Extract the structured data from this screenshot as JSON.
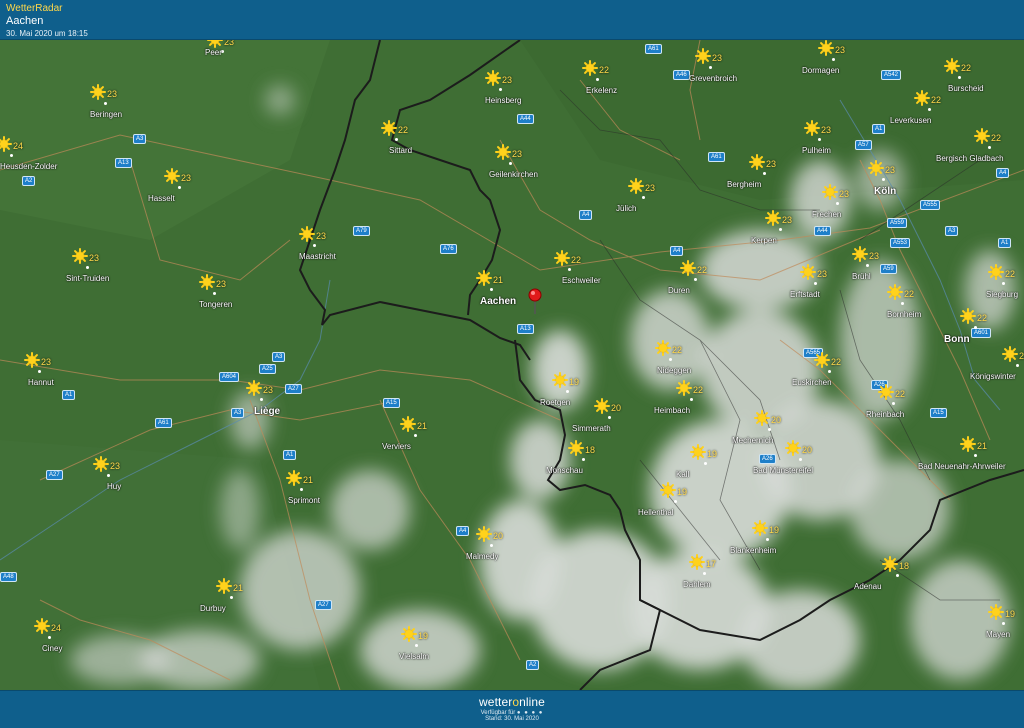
{
  "header": {
    "brand": "WetterRadar",
    "location": "Aachen",
    "timestamp": "30. Mai 2020 um 18:15"
  },
  "footer": {
    "logo_left": "wetter",
    "logo_o": "o",
    "logo_right": "nline",
    "availability": "Verfügbar für",
    "stand": "Stand: 30. Mai 2020"
  },
  "colors": {
    "map_green": "#3f6e34",
    "cloud": "#d8dbd8",
    "border": "#1c1c1c",
    "road_badge": "#1e7fc9",
    "temperature": "#ffd84a",
    "header": "#0f5f8c"
  },
  "marker_icon": "location-pin-icon",
  "weather_icons": {
    "sun": "sun-icon"
  },
  "cities": [
    {
      "name": "Peer",
      "temp": "23"
    },
    {
      "name": "Beringen",
      "temp": "23"
    },
    {
      "name": "Heinsberg",
      "temp": "23"
    },
    {
      "name": "Erkelenz",
      "temp": "22"
    },
    {
      "name": "Grevenbroich",
      "temp": "23"
    },
    {
      "name": "Dormagen",
      "temp": "23"
    },
    {
      "name": "Burscheid",
      "temp": "22"
    },
    {
      "name": "Sittard",
      "temp": "22"
    },
    {
      "name": "Leverkusen",
      "temp": "22"
    },
    {
      "name": "Pulheim",
      "temp": "23"
    },
    {
      "name": "Bergisch Gladbach",
      "temp": "22"
    },
    {
      "name": "Geilenkirchen",
      "temp": "23"
    },
    {
      "name": "Bergheim",
      "temp": "23"
    },
    {
      "name": "Köln",
      "temp": "23"
    },
    {
      "name": "Hasselt",
      "temp": "23"
    },
    {
      "name": "Jülich",
      "temp": "23"
    },
    {
      "name": "Frechen",
      "temp": "23"
    },
    {
      "name": "Kerpen",
      "temp": "23"
    },
    {
      "name": "Maastricht",
      "temp": "23"
    },
    {
      "name": "Sint-Truiden",
      "temp": "23"
    },
    {
      "name": "Eschweiler",
      "temp": "22"
    },
    {
      "name": "Brühl",
      "temp": "23"
    },
    {
      "name": "Duren",
      "temp": "22"
    },
    {
      "name": "Erftstadt",
      "temp": "23"
    },
    {
      "name": "Siegburg",
      "temp": "22"
    },
    {
      "name": "Aachen",
      "temp": "21"
    },
    {
      "name": "Tongeren",
      "temp": "23"
    },
    {
      "name": "Bornheim",
      "temp": "22"
    },
    {
      "name": "Bonn",
      "temp": "22"
    },
    {
      "name": "Hannut",
      "temp": "23"
    },
    {
      "name": "Nideggen",
      "temp": "22"
    },
    {
      "name": "Euskirchen",
      "temp": "22"
    },
    {
      "name": "Königswinter",
      "temp": "22"
    },
    {
      "name": "Liège",
      "temp": "23"
    },
    {
      "name": "Roetgen",
      "temp": "19"
    },
    {
      "name": "Heimbach",
      "temp": "22"
    },
    {
      "name": "Rheinbach",
      "temp": "22"
    },
    {
      "name": "Verviers",
      "temp": "21"
    },
    {
      "name": "Simmerath",
      "temp": "20"
    },
    {
      "name": "Mechernich",
      "temp": "20"
    },
    {
      "name": "Monschau",
      "temp": "18"
    },
    {
      "name": "Bad Neuenahr-Ahrweiler",
      "temp": "21"
    },
    {
      "name": "Huy",
      "temp": "23"
    },
    {
      "name": "Kall",
      "temp": "19"
    },
    {
      "name": "Bad Münstereifel",
      "temp": "20"
    },
    {
      "name": "Sprimont",
      "temp": "21"
    },
    {
      "name": "Hellenthal",
      "temp": "19"
    },
    {
      "name": "Malmedy",
      "temp": "20"
    },
    {
      "name": "Blankenheim",
      "temp": "19"
    },
    {
      "name": "Dahlem",
      "temp": "17"
    },
    {
      "name": "Adenau",
      "temp": "18"
    },
    {
      "name": "Durbuy",
      "temp": "21"
    },
    {
      "name": "Ciney",
      "temp": "24"
    },
    {
      "name": "Vielsalm",
      "temp": "19"
    },
    {
      "name": "Mayen",
      "temp": "19"
    },
    {
      "name": "Heusden-Zolder",
      "temp": "24"
    }
  ],
  "roads": [
    "A61",
    "A46",
    "A542",
    "A1",
    "A57",
    "A4",
    "A2",
    "A3",
    "A13",
    "A76",
    "A79",
    "A44",
    "A61",
    "A4",
    "A4",
    "A559",
    "A555",
    "A553",
    "A59",
    "A3",
    "A1",
    "A44",
    "A601",
    "A13",
    "A3",
    "A25",
    "A604",
    "A27",
    "A3",
    "A15",
    "A1",
    "A61",
    "A565",
    "A26",
    "A15",
    "A1",
    "A27",
    "A26",
    "A4",
    "A27",
    "A48",
    "A2"
  ]
}
